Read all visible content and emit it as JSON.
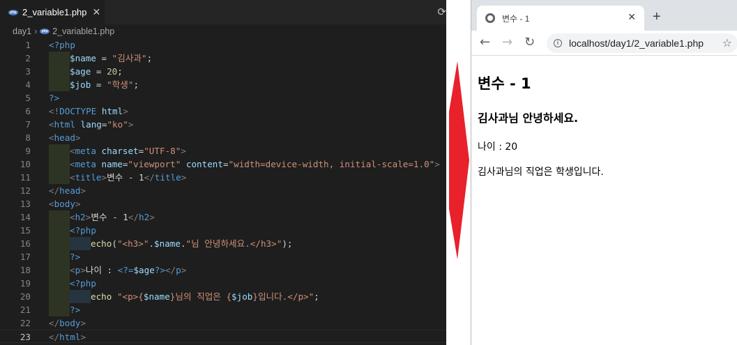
{
  "editor": {
    "tab_label": "2_variable1.php",
    "tab_close": "✕",
    "breadcrumb": [
      "day1",
      "2_variable1.php"
    ],
    "php_icon": "php-file-icon",
    "lines": [
      {
        "n": "1",
        "indent": 0,
        "parts": [
          [
            "tag",
            "<?php"
          ]
        ]
      },
      {
        "n": "2",
        "indent": 1,
        "parts": [
          [
            "var",
            "$name"
          ],
          [
            "plain",
            " = "
          ],
          [
            "str",
            "\"김사과\""
          ],
          [
            "plain",
            ";"
          ]
        ]
      },
      {
        "n": "3",
        "indent": 1,
        "parts": [
          [
            "var",
            "$age"
          ],
          [
            "plain",
            " = "
          ],
          [
            "num",
            "20"
          ],
          [
            "plain",
            ";"
          ]
        ]
      },
      {
        "n": "4",
        "indent": 1,
        "parts": [
          [
            "var",
            "$job"
          ],
          [
            "plain",
            " = "
          ],
          [
            "str",
            "\"학생\""
          ],
          [
            "plain",
            ";"
          ]
        ]
      },
      {
        "n": "5",
        "indent": 0,
        "parts": [
          [
            "tag",
            "?>"
          ]
        ]
      },
      {
        "n": "6",
        "indent": 0,
        "parts": [
          [
            "brk",
            "<!"
          ],
          [
            "tag",
            "DOCTYPE"
          ],
          [
            "plain",
            " "
          ],
          [
            "attr",
            "html"
          ],
          [
            "brk",
            ">"
          ]
        ]
      },
      {
        "n": "7",
        "indent": 0,
        "parts": [
          [
            "brk",
            "<"
          ],
          [
            "tag",
            "html"
          ],
          [
            "plain",
            " "
          ],
          [
            "attr",
            "lang"
          ],
          [
            "plain",
            "="
          ],
          [
            "str",
            "\"ko\""
          ],
          [
            "brk",
            ">"
          ]
        ]
      },
      {
        "n": "8",
        "indent": 0,
        "parts": [
          [
            "brk",
            "<"
          ],
          [
            "tag",
            "head"
          ],
          [
            "brk",
            ">"
          ]
        ]
      },
      {
        "n": "9",
        "indent": 1,
        "parts": [
          [
            "brk",
            "<"
          ],
          [
            "tag",
            "meta"
          ],
          [
            "plain",
            " "
          ],
          [
            "attr",
            "charset"
          ],
          [
            "plain",
            "="
          ],
          [
            "str",
            "\"UTF-8\""
          ],
          [
            "brk",
            ">"
          ]
        ]
      },
      {
        "n": "10",
        "indent": 1,
        "parts": [
          [
            "brk",
            "<"
          ],
          [
            "tag",
            "meta"
          ],
          [
            "plain",
            " "
          ],
          [
            "attr",
            "name"
          ],
          [
            "plain",
            "="
          ],
          [
            "str",
            "\"viewport\""
          ],
          [
            "plain",
            " "
          ],
          [
            "attr",
            "content"
          ],
          [
            "plain",
            "="
          ],
          [
            "str",
            "\"width=device-width, initial-scale=1.0\""
          ],
          [
            "brk",
            ">"
          ]
        ]
      },
      {
        "n": "11",
        "indent": 1,
        "parts": [
          [
            "brk",
            "<"
          ],
          [
            "tag",
            "title"
          ],
          [
            "brk",
            ">"
          ],
          [
            "plain",
            "변수 - 1"
          ],
          [
            "brk",
            "</"
          ],
          [
            "tag",
            "title"
          ],
          [
            "brk",
            ">"
          ]
        ]
      },
      {
        "n": "12",
        "indent": 0,
        "parts": [
          [
            "brk",
            "</"
          ],
          [
            "tag",
            "head"
          ],
          [
            "brk",
            ">"
          ]
        ]
      },
      {
        "n": "13",
        "indent": 0,
        "parts": [
          [
            "brk",
            "<"
          ],
          [
            "tag",
            "body"
          ],
          [
            "brk",
            ">"
          ]
        ]
      },
      {
        "n": "14",
        "indent": 1,
        "parts": [
          [
            "brk",
            "<"
          ],
          [
            "tag",
            "h2"
          ],
          [
            "brk",
            ">"
          ],
          [
            "plain",
            "변수 - 1"
          ],
          [
            "brk",
            "</"
          ],
          [
            "tag",
            "h2"
          ],
          [
            "brk",
            ">"
          ]
        ]
      },
      {
        "n": "15",
        "indent": 1,
        "parts": [
          [
            "tag",
            "<?php"
          ]
        ]
      },
      {
        "n": "16",
        "indent": 2,
        "parts": [
          [
            "fn",
            "echo"
          ],
          [
            "plain",
            "("
          ],
          [
            "str",
            "\"<h3>\""
          ],
          [
            "plain",
            "."
          ],
          [
            "var",
            "$name"
          ],
          [
            "plain",
            "."
          ],
          [
            "str",
            "\"님 안녕하세요.</h3>\""
          ],
          [
            "plain",
            ");"
          ]
        ]
      },
      {
        "n": "17",
        "indent": 1,
        "parts": [
          [
            "tag",
            "?>"
          ]
        ]
      },
      {
        "n": "18",
        "indent": 1,
        "parts": [
          [
            "brk",
            "<"
          ],
          [
            "tag",
            "p"
          ],
          [
            "brk",
            ">"
          ],
          [
            "plain",
            "나이 : "
          ],
          [
            "tag",
            "<?="
          ],
          [
            "var",
            "$age"
          ],
          [
            "tag",
            "?>"
          ],
          [
            "brk",
            "</"
          ],
          [
            "tag",
            "p"
          ],
          [
            "brk",
            ">"
          ]
        ]
      },
      {
        "n": "19",
        "indent": 1,
        "parts": [
          [
            "tag",
            "<?php"
          ]
        ]
      },
      {
        "n": "20",
        "indent": 2,
        "parts": [
          [
            "fn",
            "echo"
          ],
          [
            "plain",
            " "
          ],
          [
            "str",
            "\"<p>{"
          ],
          [
            "var",
            "$name"
          ],
          [
            "str",
            "}님의 직업은 {"
          ],
          [
            "var",
            "$job"
          ],
          [
            "str",
            "}입니다.</p>\""
          ],
          [
            "plain",
            ";"
          ]
        ]
      },
      {
        "n": "21",
        "indent": 1,
        "parts": [
          [
            "tag",
            "?>"
          ]
        ]
      },
      {
        "n": "22",
        "indent": 0,
        "parts": [
          [
            "brk",
            "</"
          ],
          [
            "tag",
            "body"
          ],
          [
            "brk",
            ">"
          ]
        ]
      },
      {
        "n": "23",
        "indent": 0,
        "current": true,
        "parts": [
          [
            "brk",
            "</"
          ],
          [
            "tag",
            "html"
          ],
          [
            "brk",
            ">"
          ]
        ]
      }
    ]
  },
  "colors": {
    "arrow": "#e8212b",
    "editor_bg": "#1e1e1e"
  },
  "browser": {
    "tab_title": "변수 - 1",
    "tab_close": "✕",
    "new_tab": "+",
    "url": "localhost/day1/2_variable1.php",
    "back_icon": "←",
    "forward_icon": "→",
    "reload_icon": "↻",
    "star_icon": "☆",
    "info_icon": "i",
    "page": {
      "h2": "변수 - 1",
      "h3": "김사과님 안녕하세요.",
      "p1": "나이 : 20",
      "p2": "김사과님의 직업은 학생입니다."
    }
  }
}
